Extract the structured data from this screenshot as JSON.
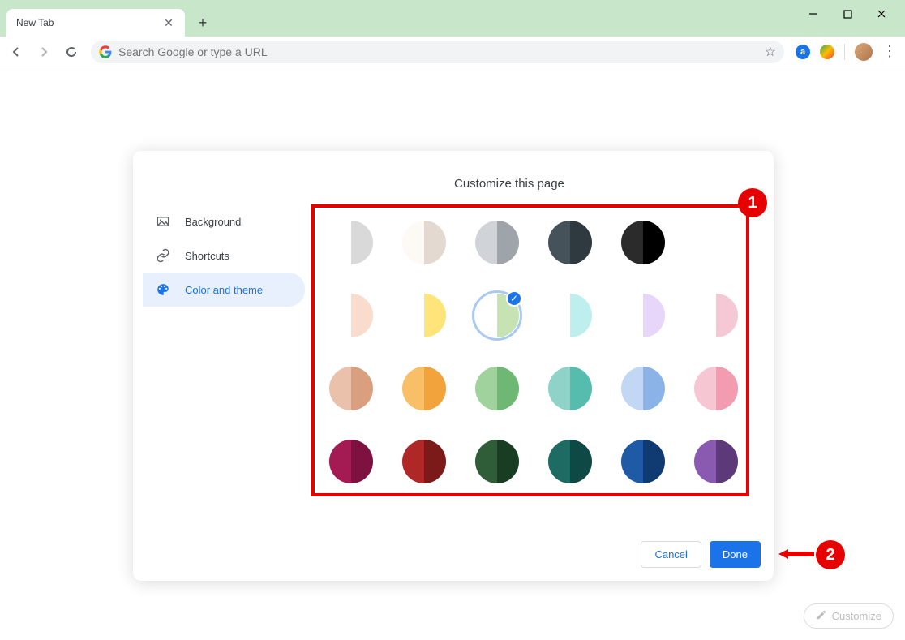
{
  "window": {
    "tab_title": "New Tab",
    "omnibox_placeholder": "Search Google or type a URL"
  },
  "dialog": {
    "title": "Customize this page",
    "sidebar": [
      {
        "label": "Background",
        "icon": "image-icon",
        "active": false
      },
      {
        "label": "Shortcuts",
        "icon": "link-icon",
        "active": false
      },
      {
        "label": "Color and theme",
        "icon": "palette-icon",
        "active": true
      }
    ],
    "colors": [
      {
        "l": "#ffffff",
        "r": "#d9d9d9"
      },
      {
        "l": "#fdfaf6",
        "r": "#e3d9d0"
      },
      {
        "l": "#d0d3d7",
        "r": "#9fa4aa"
      },
      {
        "l": "#45525a",
        "r": "#2e3a40"
      },
      {
        "l": "#2b2b2b",
        "r": "#000000"
      },
      null,
      {
        "l": "#ffffff",
        "r": "#f9dccb"
      },
      {
        "l": "#ffffff",
        "r": "#ffe479"
      },
      {
        "l": "#ffffff",
        "r": "#c7e3b3",
        "selected": true
      },
      {
        "l": "#ffffff",
        "r": "#bfeeee"
      },
      {
        "l": "#ffffff",
        "r": "#e7d6fa"
      },
      {
        "l": "#ffffff",
        "r": "#f5c8d5"
      },
      {
        "l": "#eac2ac",
        "r": "#d99f7f"
      },
      {
        "l": "#f8bf67",
        "r": "#f2a33c"
      },
      {
        "l": "#9fd29c",
        "r": "#6fb874"
      },
      {
        "l": "#8ed2c8",
        "r": "#55bcae"
      },
      {
        "l": "#c2d7f3",
        "r": "#8cb3e8"
      },
      {
        "l": "#f7c6d3",
        "r": "#f29bb1"
      },
      {
        "l": "#a41a53",
        "r": "#7d1140"
      },
      {
        "l": "#b02727",
        "r": "#7c1a1a"
      },
      {
        "l": "#2e5d38",
        "r": "#183d22"
      },
      {
        "l": "#1e6b64",
        "r": "#0f4945"
      },
      {
        "l": "#1f5aa6",
        "r": "#103a72"
      },
      {
        "l": "#8a5ab0",
        "r": "#5c3a79"
      }
    ],
    "cancel_label": "Cancel",
    "done_label": "Done"
  },
  "annotations": {
    "badge1": "1",
    "badge2": "2"
  },
  "customize_chip": "Customize"
}
